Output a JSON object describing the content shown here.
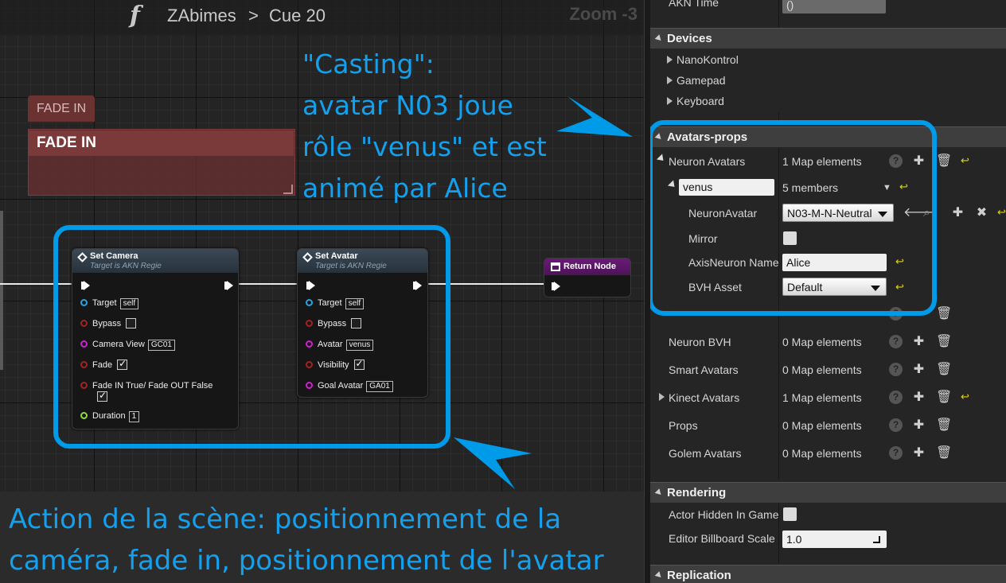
{
  "graph": {
    "breadcrumb": {
      "root": "ZAbimes",
      "separator": ">",
      "current": "Cue 20"
    },
    "zoom": "Zoom -3",
    "comment": {
      "tab": "FADE IN",
      "title": "FADE IN"
    },
    "set_camera": {
      "title": "Set Camera",
      "subtitle": "Target is AKN Regie",
      "target_label": "Target",
      "target_value": "self",
      "bypass_label": "Bypass",
      "camera_view_label": "Camera View",
      "camera_view_value": "GC01",
      "fade_label": "Fade",
      "fade_in_label": "Fade IN True/ Fade OUT False",
      "duration_label": "Duration",
      "duration_value": "1"
    },
    "set_avatar": {
      "title": "Set Avatar",
      "subtitle": "Target is AKN Regie",
      "target_label": "Target",
      "target_value": "self",
      "bypass_label": "Bypass",
      "avatar_label": "Avatar",
      "avatar_value": "venus",
      "visibility_label": "Visibility",
      "goal_avatar_label": "Goal Avatar",
      "goal_avatar_value": "GA01"
    },
    "return_node": {
      "title": "Return Node"
    }
  },
  "annotations": {
    "casting_lines": [
      "\"Casting\":",
      "avatar N03 joue",
      "rôle \"venus\" et est",
      "animé par Alice"
    ],
    "action_lines": [
      "Action de la scène: positionnement de la",
      "caméra, fade in, positionnement de  l'avatar"
    ]
  },
  "details": {
    "akn_time": {
      "label": "AKN Time",
      "value": "()"
    },
    "devices": {
      "title": "Devices",
      "items": [
        "NanoKontrol",
        "Gamepad",
        "Keyboard"
      ]
    },
    "avatars_props": {
      "title": "Avatars-props",
      "neuron_avatars": {
        "label": "Neuron Avatars",
        "value": "1 Map elements"
      },
      "venus": {
        "key": "venus",
        "value": "5 members"
      },
      "neuron_avatar": {
        "label": "NeuronAvatar",
        "value": "N03-M-N-Neutral"
      },
      "mirror": {
        "label": "Mirror"
      },
      "axis_neuron_name": {
        "label": "AxisNeuron Name",
        "value": "Alice"
      },
      "bvh_asset": {
        "label": "BVH Asset",
        "value": "Default"
      },
      "neuron_bvh": {
        "label": "Neuron BVH",
        "value": "0 Map elements"
      },
      "smart_avatars": {
        "label": "Smart Avatars",
        "value": "0 Map elements"
      },
      "kinect_avatars": {
        "label": "Kinect Avatars",
        "value": "1 Map elements"
      },
      "props": {
        "label": "Props",
        "value": "0 Map elements"
      },
      "golem_avatars": {
        "label": "Golem Avatars",
        "value": "0 Map elements"
      }
    },
    "rendering": {
      "title": "Rendering",
      "actor_hidden": {
        "label": "Actor Hidden In Game"
      },
      "editor_billboard": {
        "label": "Editor Billboard Scale",
        "value": "1.0"
      }
    },
    "replication": {
      "title": "Replication"
    }
  },
  "colors": {
    "annotation": "#14a0ec",
    "highlight": "#009be8",
    "comment": "#6b3232",
    "return_node": "#6a1a78"
  }
}
